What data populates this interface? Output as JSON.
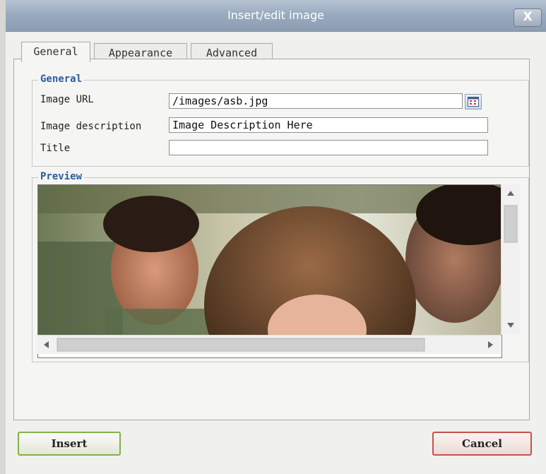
{
  "window": {
    "title": "Insert/edit image",
    "close_label": "X"
  },
  "tabs": [
    {
      "label": "General",
      "active": true
    },
    {
      "label": "Appearance",
      "active": false
    },
    {
      "label": "Advanced",
      "active": false
    }
  ],
  "general": {
    "legend": "General",
    "image_url": {
      "label": "Image URL",
      "value": "/images/asb.jpg"
    },
    "image_description": {
      "label": "Image description",
      "value": "Image Description Here"
    },
    "title": {
      "label": "Title",
      "value": ""
    },
    "browse_icon": "browse-icon"
  },
  "preview": {
    "legend": "Preview"
  },
  "buttons": {
    "insert": "Insert",
    "cancel": "Cancel"
  },
  "colors": {
    "titlebar": "#9aabbf",
    "legend": "#2b5d9e",
    "insert_border": "#7fb24a",
    "cancel_border": "#c9514a"
  }
}
